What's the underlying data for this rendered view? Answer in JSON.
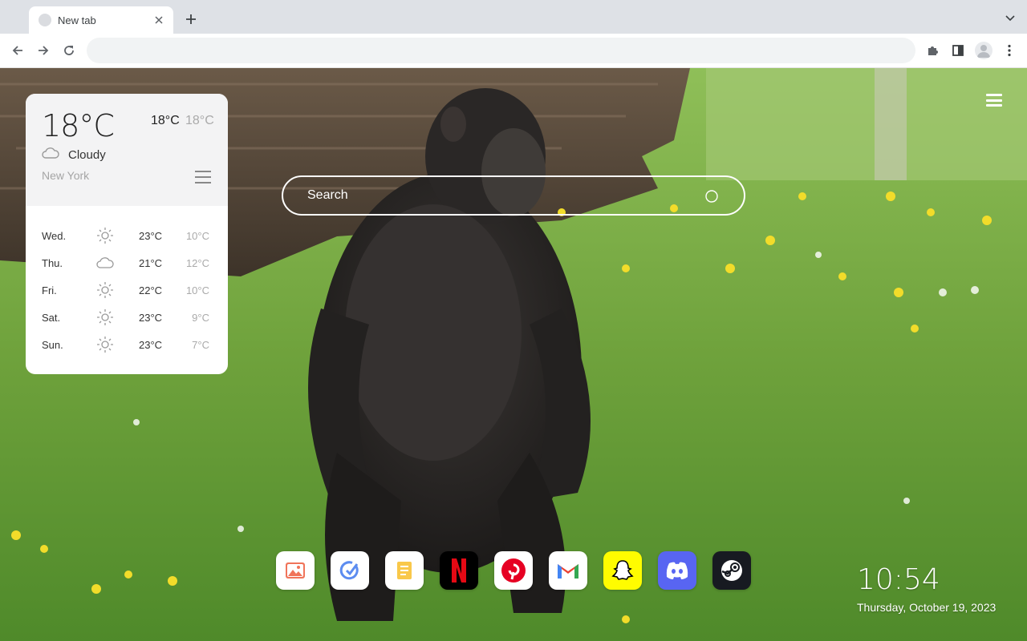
{
  "browser": {
    "tab_title": "New tab",
    "tab_close_icon": "close-icon",
    "new_tab_icon": "plus-icon",
    "tab_search_icon": "chevron-down-icon",
    "address_placeholder": "",
    "address_value": ""
  },
  "toolbar": {
    "back_icon": "arrow-left-icon",
    "forward_icon": "arrow-right-icon",
    "reload_icon": "reload-icon",
    "extensions_icon": "puzzle-icon",
    "side_panel_icon": "side-panel-icon",
    "profile_icon": "avatar-icon",
    "menu_icon": "kebab-menu-icon"
  },
  "weather": {
    "current_temp": "18°C",
    "high": "18°C",
    "low": "18°C",
    "condition": "Cloudy",
    "condition_icon": "cloud-icon",
    "city": "New York",
    "forecast": [
      {
        "day": "Wed.",
        "icon": "sun-icon",
        "high": "23°C",
        "low": "10°C"
      },
      {
        "day": "Thu.",
        "icon": "cloud-icon",
        "high": "21°C",
        "low": "12°C"
      },
      {
        "day": "Fri.",
        "icon": "sun-icon",
        "high": "22°C",
        "low": "10°C"
      },
      {
        "day": "Sat.",
        "icon": "sun-icon",
        "high": "23°C",
        "low": "9°C"
      },
      {
        "day": "Sun.",
        "icon": "sun-icon",
        "high": "23°C",
        "low": "7°C"
      }
    ]
  },
  "search": {
    "placeholder": "Search"
  },
  "dock": [
    {
      "name": "gallery",
      "icon": "image-icon"
    },
    {
      "name": "tasks",
      "icon": "check-icon"
    },
    {
      "name": "notes",
      "icon": "note-icon"
    },
    {
      "name": "netflix",
      "icon": "netflix-icon"
    },
    {
      "name": "pinterest",
      "icon": "pinterest-icon"
    },
    {
      "name": "gmail",
      "icon": "gmail-icon"
    },
    {
      "name": "snapchat",
      "icon": "snapchat-icon"
    },
    {
      "name": "discord",
      "icon": "discord-icon"
    },
    {
      "name": "steam",
      "icon": "steam-icon"
    }
  ],
  "clock": {
    "time": "10:54",
    "date": "Thursday, October 19, 2023"
  },
  "colors": {
    "netflix": "#e50914",
    "pinterest": "#e60023",
    "snapchat": "#fffc00",
    "discord": "#5865f2",
    "steam": "#171a21"
  }
}
